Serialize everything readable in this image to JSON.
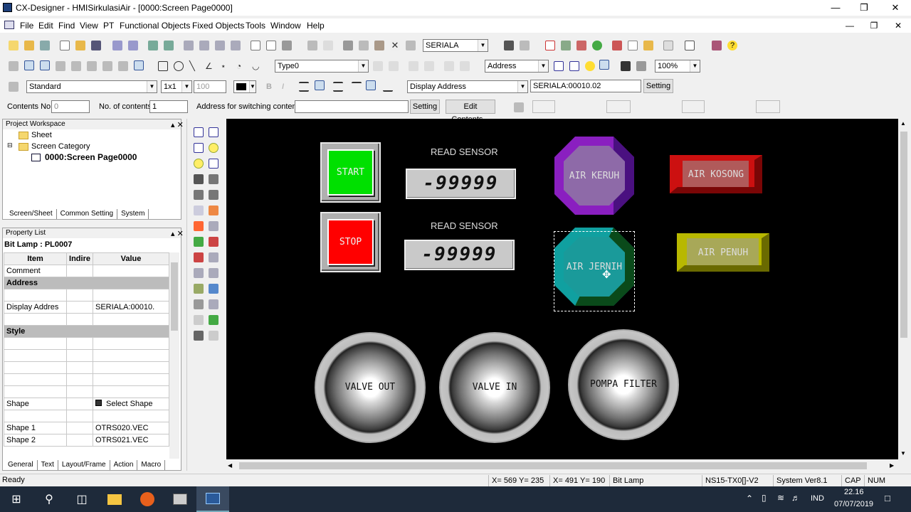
{
  "window": {
    "title": "CX-Designer - HMISirkulasiAir - [0000:Screen Page0000]"
  },
  "menu": [
    "File",
    "Edit",
    "Find",
    "View",
    "PT",
    "Functional Objects",
    "Fixed Objects",
    "Tools",
    "Window",
    "Help"
  ],
  "toolbar1": {
    "port": "SERIALA"
  },
  "toolbar2": {
    "type": "Type0",
    "addr_mode": "Address",
    "zoom": "100%"
  },
  "toolbar3": {
    "font": "Standard",
    "scale": "1x1",
    "size": "100",
    "display_addr_label": "Display Address",
    "address": "SERIALA:00010.02",
    "setting": "Setting"
  },
  "toolbar4": {
    "contents_no_label": "Contents No.",
    "contents_no": "0",
    "num_contents_label": "No. of contents",
    "num_contents": "1",
    "switch_label": "Address for switching contents",
    "setting": "Setting",
    "edit_contents": "Edit Contents..."
  },
  "workspace": {
    "title": "Project Workspace",
    "tree": [
      "Sheet",
      "Screen Category",
      "0000:Screen Page0000"
    ],
    "tabs": [
      "Screen/Sheet",
      "Common Setting",
      "System"
    ]
  },
  "property": {
    "title": "Property List",
    "object": "Bit Lamp : PL0007",
    "headers": [
      "Item",
      "Indire",
      "Value"
    ],
    "rows": [
      {
        "item": "Comment",
        "value": ""
      },
      {
        "section": "Address"
      },
      {
        "item": "",
        "value": ""
      },
      {
        "item": "Display Addres",
        "value": "SERIALA:00010."
      },
      {
        "item": "",
        "value": ""
      },
      {
        "section": "Style"
      },
      {
        "item": "",
        "value": ""
      },
      {
        "item": "",
        "value": ""
      },
      {
        "item": "",
        "value": ""
      },
      {
        "item": "",
        "value": ""
      },
      {
        "item": "",
        "value": ""
      },
      {
        "item": "Shape",
        "value": "Select Shape"
      },
      {
        "item": "",
        "value": ""
      },
      {
        "item": "Shape 1",
        "value": "OTRS020.VEC"
      },
      {
        "item": "Shape 2",
        "value": "OTRS021.VEC"
      }
    ],
    "tabs": [
      "General",
      "Text",
      "Layout/Frame",
      "Action",
      "Macro"
    ]
  },
  "canvas": {
    "start": "START",
    "stop": "STOP",
    "read1": "READ SENSOR",
    "read2": "READ SENSOR",
    "val1": "-99999",
    "val2": "-99999",
    "keruh": "AIR KERUH",
    "kosong": "AIR KOSONG",
    "jernih": "AIR JERNIH",
    "penuh": "AIR PENUH",
    "valve_out": "VALVE OUT",
    "valve_in": "VALVE IN",
    "pompa": "POMPA FILTER"
  },
  "status": {
    "ready": "Ready",
    "xy1": "X= 569 Y= 235",
    "xy2": "X= 491 Y= 190",
    "object": "Bit Lamp",
    "model": "NS15-TX0[]-V2",
    "sysver": "System Ver8.1",
    "cap": "CAP",
    "num": "NUM"
  },
  "taskbar": {
    "lang": "IND",
    "time": "22.16",
    "date": "07/07/2019"
  },
  "colors": {
    "start": "#00e000",
    "stop": "#ff0000",
    "keruh": "#8a2be2",
    "kosong": "#cc1010",
    "jernih": "#109e9e",
    "penuh": "#b8b800"
  }
}
